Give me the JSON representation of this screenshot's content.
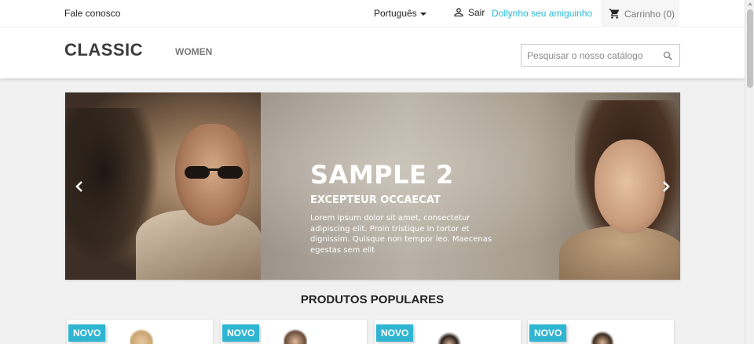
{
  "topnav": {
    "contact_label": "Fale conosco",
    "language_label": "Português",
    "logout_label": "Sair",
    "account_label": "Dollynho seu amiguinho",
    "cart_label": "Carrinho (0)"
  },
  "header": {
    "logo": "CLASSIC",
    "menu": [
      "WOMEN"
    ],
    "search_placeholder": "Pesquisar o nosso catálogo"
  },
  "slider": {
    "title": "SAMPLE 2",
    "subtitle": "EXCEPTEUR OCCAECAT",
    "text": "Lorem ipsum dolor sit amet, consectetur adipiscing elit. Proin tristique in tortor et dignissim. Quisque non tempor leo. Maecenas egestas sem elit"
  },
  "section": {
    "title": "PRODUTOS POPULARES"
  },
  "products": [
    {
      "badge": "NOVO"
    },
    {
      "badge": "NOVO"
    },
    {
      "badge": "NOVO"
    },
    {
      "badge": "NOVO"
    }
  ],
  "colors": {
    "accent": "#24b9d7",
    "badge": "#2fb5d2"
  },
  "icons": {
    "language": "chevron-down-icon",
    "logout": "user-icon",
    "cart": "cart-icon",
    "search": "search-icon",
    "prev": "chevron-left-icon",
    "next": "chevron-right-icon"
  }
}
